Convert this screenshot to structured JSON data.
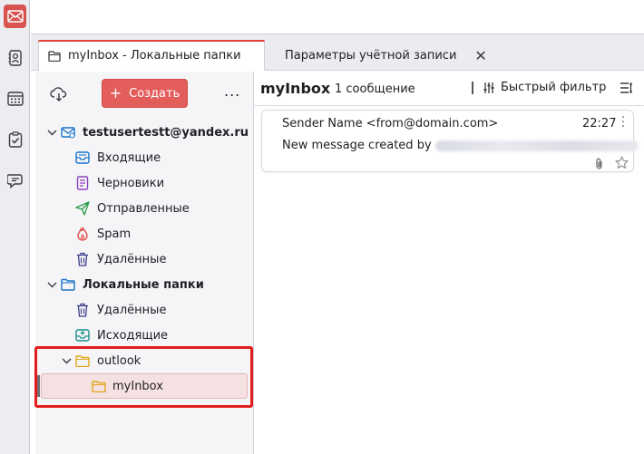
{
  "spaces": {
    "items": [
      {
        "icon": "mail-icon",
        "active": true
      },
      {
        "icon": "address-book-icon"
      },
      {
        "icon": "calendar-icon"
      },
      {
        "icon": "tasks-icon"
      },
      {
        "icon": "chat-icon"
      }
    ]
  },
  "tabs": [
    {
      "label": "myInbox - Локальные папки",
      "icon": "folder-tab-icon",
      "active": true
    },
    {
      "label": "Параметры учётной записи",
      "icon": "account-settings-icon"
    }
  ],
  "folder_pane": {
    "create_label": "Создать",
    "create_icon": "+",
    "more_label": "...",
    "tree": [
      {
        "type": "account",
        "label": "testusertestt@yandex.ru",
        "icon": "mail-account-icon"
      },
      {
        "type": "folder",
        "label": "Входящие",
        "icon": "inbox-icon"
      },
      {
        "type": "folder",
        "label": "Черновики",
        "icon": "drafts-icon"
      },
      {
        "type": "folder",
        "label": "Отправленные",
        "icon": "sent-icon"
      },
      {
        "type": "folder",
        "label": "Spam",
        "icon": "spam-icon"
      },
      {
        "type": "folder",
        "label": "Удалённые",
        "icon": "trash-icon"
      },
      {
        "type": "account",
        "label": "Локальные папки",
        "icon": "local-folders-icon"
      },
      {
        "type": "folder",
        "label": "Удалённые",
        "icon": "trash-icon"
      },
      {
        "type": "folder",
        "label": "Исходящие",
        "icon": "outbox-icon"
      },
      {
        "type": "folder",
        "label": "outlook",
        "icon": "folder-icon"
      },
      {
        "type": "folder",
        "label": "myInbox",
        "icon": "folder-icon",
        "selected": true
      }
    ]
  },
  "message_list": {
    "folder_name": "myInbox",
    "count": "1 сообщение",
    "quick_filter_label": "Быстрый фильтр",
    "messages": [
      {
        "sender": "Sender Name <from@domain.com>",
        "time": "22:27",
        "subject": "New message created by"
      }
    ]
  },
  "colors": {
    "accent": "#e35e5b",
    "highlight": "#e41c1c",
    "selected_bg": "#f5e1e1"
  }
}
